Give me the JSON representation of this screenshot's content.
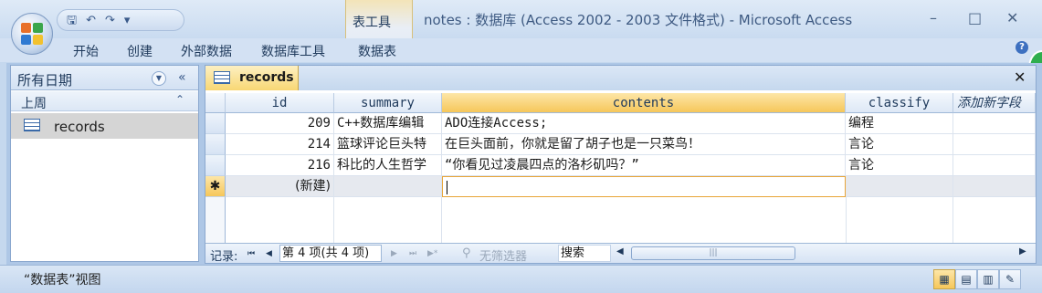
{
  "window": {
    "title": "notes : 数据库 (Access 2002 - 2003 文件格式) - Microsoft Access",
    "context_tab_label": "表工具",
    "minimize": "–",
    "maximize": "□",
    "close": "✕"
  },
  "quick_access": {
    "save_icon": "save-icon",
    "undo_icon": "undo-icon",
    "redo_icon": "redo-icon"
  },
  "ribbon": {
    "tabs": [
      "开始",
      "创建",
      "外部数据",
      "数据库工具",
      "数据表"
    ],
    "help": "?"
  },
  "nav_pane": {
    "title": "所有日期",
    "collapse": "«",
    "group": "上周",
    "group_chevron": "≈",
    "items": [
      {
        "label": "records"
      }
    ]
  },
  "document": {
    "tab_label": "records",
    "close": "✕"
  },
  "table": {
    "columns": [
      "id",
      "summary",
      "contents",
      "classify",
      "添加新字段"
    ],
    "rows": [
      {
        "id": "209",
        "summary": "C++数据库编辑",
        "contents": "ADO连接Access;",
        "classify": "编程"
      },
      {
        "id": "214",
        "summary": "篮球评论巨头特",
        "contents": "在巨头面前，你就是留了胡子也是一只菜鸟！",
        "classify": "言论"
      },
      {
        "id": "216",
        "summary": "科比的人生哲学",
        "contents": "“你看见过凌晨四点的洛杉矶吗？”",
        "classify": "言论"
      }
    ],
    "new_row_marker": "✱",
    "new_row_label": "(新建)"
  },
  "record_nav": {
    "label": "记录:",
    "first": "⏮",
    "prev": "◀",
    "position": "第 4 项(共 4 项)",
    "next": "▶",
    "last": "⏭",
    "new": "▶*",
    "filter": "无筛选器",
    "search": "搜索",
    "scroll_left": "◀",
    "scroll_right": "▶",
    "thumb_grip": "|||"
  },
  "status_bar": {
    "text": "“数据表”视图",
    "views": [
      "datasheet-view-icon",
      "pivottable-view-icon",
      "pivotchart-view-icon",
      "design-view-icon"
    ]
  },
  "colors": {
    "accent_orange": "#f6c75a",
    "ribbon_blue": "#c5d8ee"
  }
}
